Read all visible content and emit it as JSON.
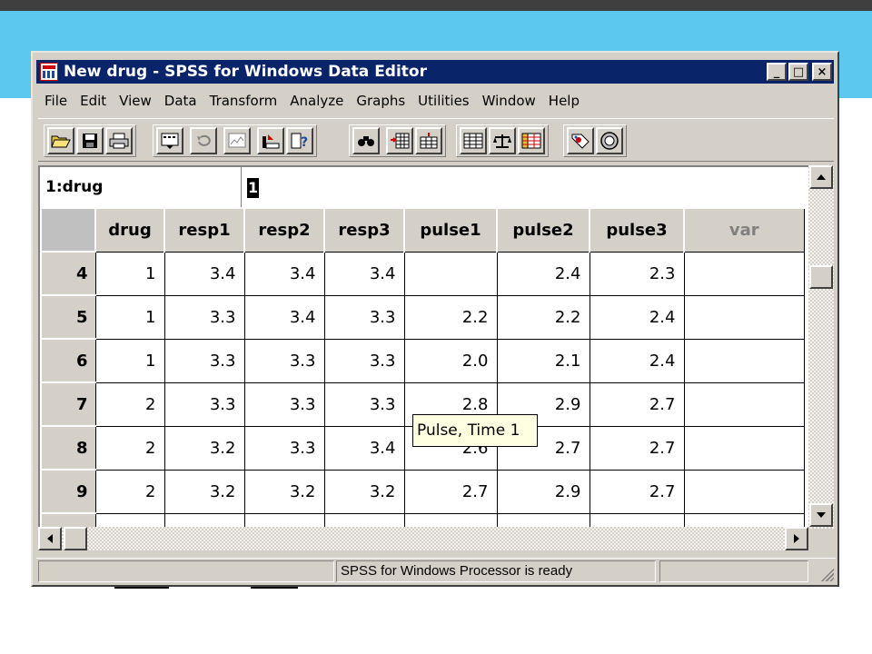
{
  "window": {
    "title": "New drug - SPSS for Windows Data Editor",
    "minimize_label": "_",
    "maximize_label": "□",
    "close_label": "×"
  },
  "menu": [
    {
      "label": "File"
    },
    {
      "label": "Edit"
    },
    {
      "label": "View"
    },
    {
      "label": "Data"
    },
    {
      "label": "Transform"
    },
    {
      "label": "Analyze"
    },
    {
      "label": "Graphs"
    },
    {
      "label": "Utilities"
    },
    {
      "label": "Window"
    },
    {
      "label": "Help"
    }
  ],
  "toolbar": {
    "icons": [
      "open-file-icon",
      "save-icon",
      "print-icon",
      "dialog-recall-icon",
      "undo-icon",
      "goto-chart-icon",
      "goto-case-icon",
      "variables-icon",
      "find-icon",
      "insert-case-icon",
      "insert-variable-icon",
      "split-file-icon",
      "weight-cases-icon",
      "select-cases-icon",
      "value-labels-icon",
      "use-sets-icon"
    ]
  },
  "cell_editor": {
    "reference": "1:drug",
    "value": "1"
  },
  "grid": {
    "columns": [
      "drug",
      "resp1",
      "resp2",
      "resp3",
      "pulse1",
      "pulse2",
      "pulse3",
      "var"
    ],
    "rows": [
      {
        "row": "4",
        "cells": [
          "1",
          "3.4",
          "3.4",
          "3.4",
          "",
          "2.4",
          "2.3",
          ""
        ]
      },
      {
        "row": "5",
        "cells": [
          "1",
          "3.3",
          "3.4",
          "3.3",
          "2.2",
          "2.2",
          "2.4",
          ""
        ]
      },
      {
        "row": "6",
        "cells": [
          "1",
          "3.3",
          "3.3",
          "3.3",
          "2.0",
          "2.1",
          "2.4",
          ""
        ]
      },
      {
        "row": "7",
        "cells": [
          "2",
          "3.3",
          "3.3",
          "3.3",
          "2.8",
          "2.9",
          "2.7",
          ""
        ]
      },
      {
        "row": "8",
        "cells": [
          "2",
          "3.2",
          "3.3",
          "3.4",
          "2.6",
          "2.7",
          "2.7",
          ""
        ]
      },
      {
        "row": "9",
        "cells": [
          "2",
          "3.2",
          "3.2",
          "3.2",
          "2.7",
          "2.9",
          "2.7",
          ""
        ]
      }
    ]
  },
  "tooltip": "Pulse, Time 1",
  "status": {
    "message": "SPSS for Windows Processor is ready",
    "secondary": ""
  }
}
